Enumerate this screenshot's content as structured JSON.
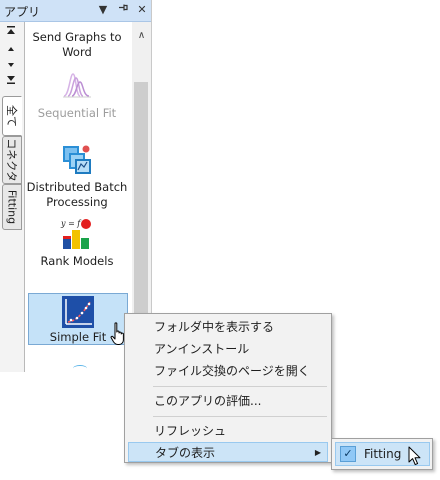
{
  "panel": {
    "title": "アプリ",
    "dropdown_glyph": "▼",
    "pin_glyph": "ꟷ",
    "close_glyph": "✕",
    "side_controls": [
      "⏶",
      "▲",
      "▼",
      "⏷"
    ],
    "tabs": [
      "全て",
      "コネクタ",
      "Fitting"
    ],
    "scroll_up_glyph": "∧"
  },
  "apps": {
    "send_graphs": {
      "label": "Send Graphs to Word"
    },
    "sequential_fit": {
      "label": "Sequential Fit",
      "icon": "sequential-fit-icon"
    },
    "distributed_batch": {
      "label": "Distributed Batch Processing",
      "icon": "distributed-batch-icon"
    },
    "rank_models": {
      "label": "Rank Models",
      "icon": "rank-models-icon",
      "formula": "y = f"
    },
    "simple_fit": {
      "label": "Simple Fit",
      "icon": "simple-fit-icon"
    }
  },
  "menu": {
    "items": [
      "フォルダ中を表示する",
      "アンインストール",
      "ファイル交換のページを開く",
      "このアプリの評価...",
      "リフレッシュ",
      "タブの表示"
    ],
    "submenu_arrow": "▶"
  },
  "submenu": {
    "item": "Fitting",
    "checked": true,
    "check_glyph": "✓"
  },
  "colors": {
    "accent": "#0078d7",
    "hover": "#cce4f7",
    "titlebar": "#cfe2f7"
  }
}
